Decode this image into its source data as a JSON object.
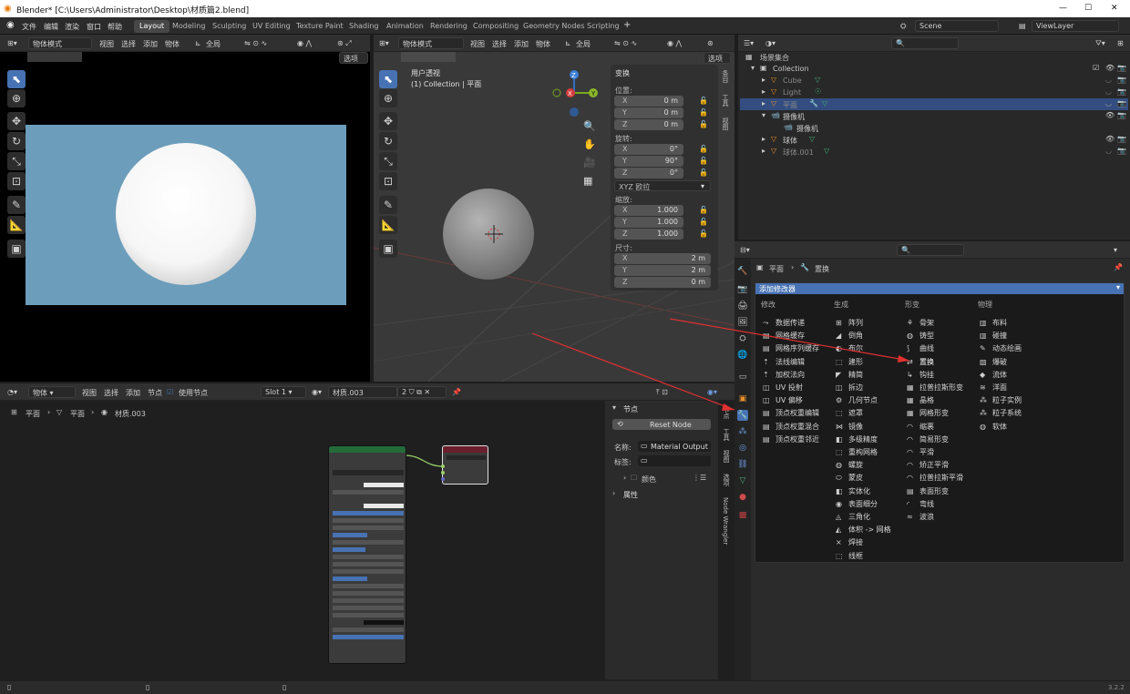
{
  "window": {
    "title": "Blender* [C:\\Users\\Administrator\\Desktop\\材质篇2.blend]",
    "minimize": "—",
    "maximize": "☐",
    "close": "✕"
  },
  "menu": {
    "items": [
      "文件",
      "编辑",
      "渲染",
      "窗口",
      "帮助"
    ]
  },
  "workspaces": [
    "Layout",
    "Modeling",
    "Sculpting",
    "UV Editing",
    "Texture Paint",
    "Shading",
    "Animation",
    "Rendering",
    "Compositing",
    "Geometry Nodes",
    "Scripting"
  ],
  "workspace_add": "+",
  "scene": {
    "label": "Scene",
    "view_layer": "ViewLayer"
  },
  "left_viewport": {
    "mode": "物体模式",
    "menus": [
      "视图",
      "选择",
      "添加",
      "物体"
    ],
    "orientation": "全局",
    "options": "选项"
  },
  "main_viewport": {
    "mode": "物体模式",
    "menus": [
      "视图",
      "选择",
      "添加",
      "物体"
    ],
    "orientation": "全局",
    "options": "选项",
    "view_name": "用户透视",
    "collection_info": "(1) Collection | 平面",
    "gizmo": {
      "z": "Z",
      "y": "Y",
      "x": "X"
    }
  },
  "transform": {
    "title": "变换",
    "location_label": "位置:",
    "location": [
      {
        "axis": "X",
        "value": "0 m"
      },
      {
        "axis": "Y",
        "value": "0 m"
      },
      {
        "axis": "Z",
        "value": "0 m"
      }
    ],
    "rotation_label": "旋转:",
    "rotation": [
      {
        "axis": "X",
        "value": "0°"
      },
      {
        "axis": "Y",
        "value": "90°"
      },
      {
        "axis": "Z",
        "value": "0°"
      }
    ],
    "rotation_mode": "XYZ 欧拉",
    "scale_label": "缩放:",
    "scale": [
      {
        "axis": "X",
        "value": "1.000"
      },
      {
        "axis": "Y",
        "value": "1.000"
      },
      {
        "axis": "Z",
        "value": "1.000"
      }
    ],
    "dimensions_label": "尺寸:",
    "dimensions": [
      {
        "axis": "X",
        "value": "2 m"
      },
      {
        "axis": "Y",
        "value": "2 m"
      },
      {
        "axis": "Z",
        "value": "0 m"
      }
    ]
  },
  "npanel_tabs": [
    "条目",
    "工具",
    "视图"
  ],
  "outliner": {
    "scene_collection": "场景集合",
    "rows": [
      {
        "name": "Collection",
        "indent": 1
      },
      {
        "name": "Cube",
        "indent": 2
      },
      {
        "name": "Light",
        "indent": 2
      },
      {
        "name": "平面",
        "indent": 2
      },
      {
        "name": "摄像机",
        "indent": 2
      },
      {
        "name": "摄像机",
        "indent": 3
      },
      {
        "name": "球体",
        "indent": 2
      },
      {
        "name": "球体.001",
        "indent": 2
      }
    ]
  },
  "properties": {
    "breadcrumb_object": "平面",
    "breadcrumb_modifier": "置换",
    "add_modifier": "添加修改器",
    "columns": [
      {
        "title": "修改",
        "items": [
          "数据传递",
          "网格缓存",
          "网格序列缓存",
          "法线编辑",
          "加权法向",
          "UV 投射",
          "UV 偏移",
          "顶点权重编辑",
          "顶点权重混合",
          "顶点权重邻近"
        ]
      },
      {
        "title": "生成",
        "items": [
          "阵列",
          "倒角",
          "布尔",
          "建形",
          "精简",
          "拆边",
          "几何节点",
          "遮罩",
          "镜像",
          "多级精度",
          "重构网格",
          "螺旋",
          "蒙皮",
          "实体化",
          "表面细分",
          "三角化",
          "体积 -> 网格",
          "焊接",
          "线框"
        ]
      },
      {
        "title": "形变",
        "items": [
          "骨架",
          "铸型",
          "曲线",
          "置换",
          "钩挂",
          "拉普拉斯形变",
          "晶格",
          "网格形变",
          "缩裹",
          "简易形变",
          "平滑",
          "矫正平滑",
          "拉普拉斯平滑",
          "表面形变",
          "弯线",
          "波浪"
        ]
      },
      {
        "title": "物理",
        "items": [
          "布料",
          "碰撞",
          "动态绘画",
          "爆破",
          "流体",
          "洋面",
          "粒子实例",
          "粒子系统",
          "软体"
        ]
      }
    ]
  },
  "node_editor": {
    "menus": [
      "物体",
      "视图",
      "选择",
      "添加",
      "节点"
    ],
    "use_nodes": "使用节点",
    "slot": "Slot 1",
    "material": "材质.003",
    "users": "2",
    "breadcrumb": [
      "平面",
      "平面",
      "材质.003"
    ],
    "panel": {
      "title": "节点",
      "reset": "Reset Node",
      "name_label": "名称:",
      "name_value": "Material Output",
      "label_label": "标签:",
      "label_value": "",
      "color": "颜色",
      "properties": "属性"
    },
    "vtabs": [
      "节点",
      "工具",
      "视图",
      "选项",
      "Node Wrangler"
    ]
  },
  "version": "3.2.2"
}
